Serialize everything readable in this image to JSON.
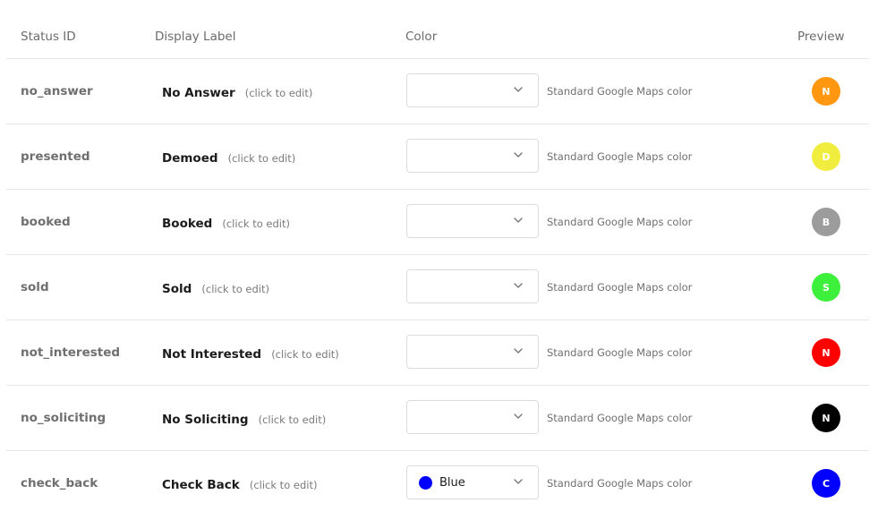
{
  "headers": {
    "status_id": "Status ID",
    "display_label": "Display Label",
    "color": "Color",
    "preview": "Preview"
  },
  "edit_hint": "(click to edit)",
  "color_note": "Standard Google Maps color",
  "rows": [
    {
      "status_id": "no_answer",
      "label": "No Answer",
      "selected_color": "",
      "swatch_color": "",
      "preview_letter": "N",
      "preview_color": "#ff9810"
    },
    {
      "status_id": "presented",
      "label": "Demoed",
      "selected_color": "",
      "swatch_color": "",
      "preview_letter": "D",
      "preview_color": "#f0ed3e"
    },
    {
      "status_id": "booked",
      "label": "Booked",
      "selected_color": "",
      "swatch_color": "",
      "preview_letter": "B",
      "preview_color": "#9c9c9c"
    },
    {
      "status_id": "sold",
      "label": "Sold",
      "selected_color": "",
      "swatch_color": "",
      "preview_letter": "S",
      "preview_color": "#3df03b"
    },
    {
      "status_id": "not_interested",
      "label": "Not Interested",
      "selected_color": "",
      "swatch_color": "",
      "preview_letter": "N",
      "preview_color": "#ff0000"
    },
    {
      "status_id": "no_soliciting",
      "label": "No Soliciting",
      "selected_color": "",
      "swatch_color": "",
      "preview_letter": "N",
      "preview_color": "#000000"
    },
    {
      "status_id": "check_back",
      "label": "Check Back",
      "selected_color": "Blue",
      "swatch_color": "#0000ff",
      "preview_letter": "C",
      "preview_color": "#0000ff"
    }
  ]
}
